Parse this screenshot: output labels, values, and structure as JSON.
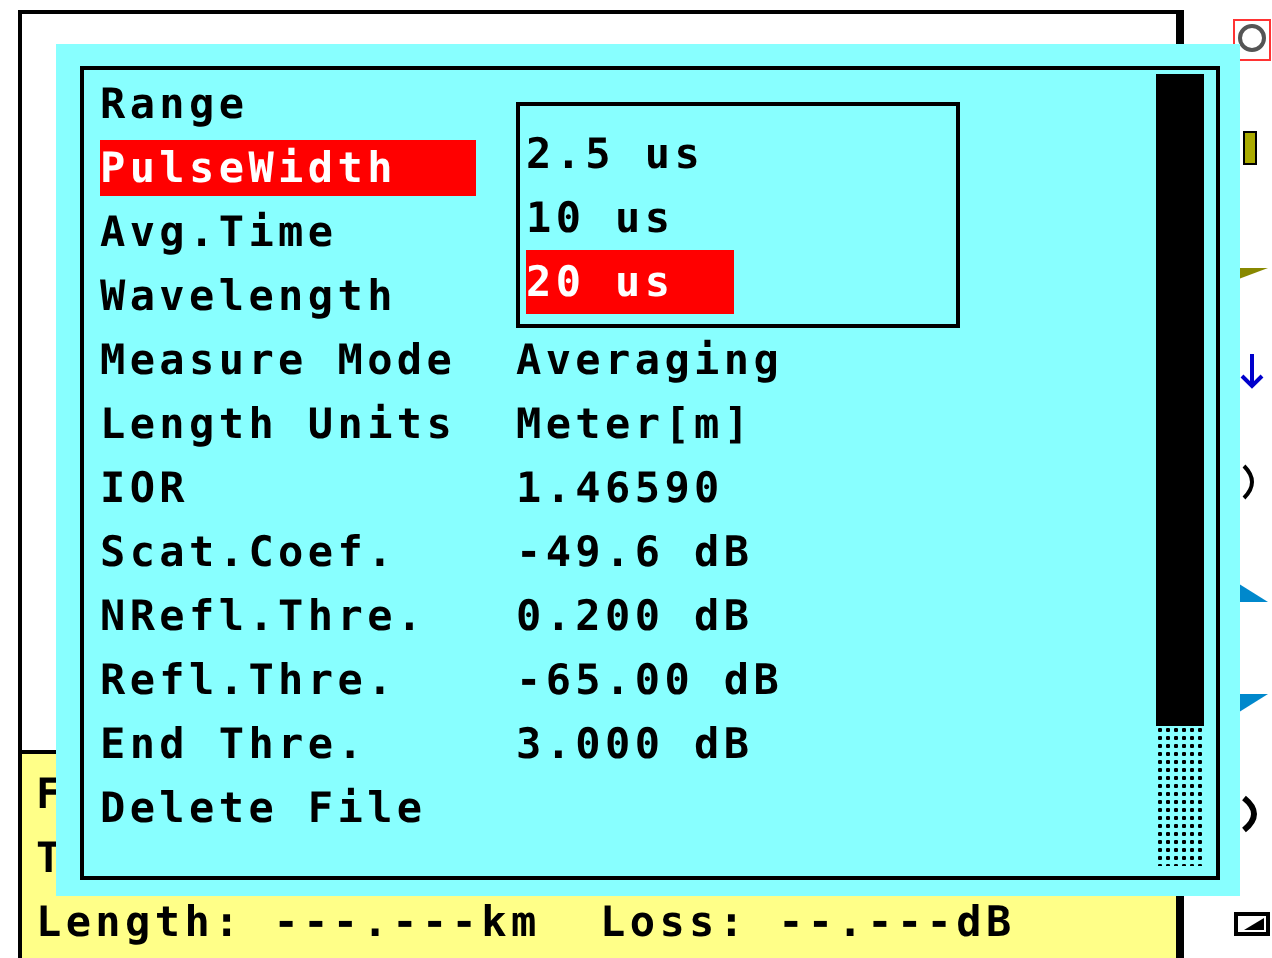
{
  "menu": {
    "items": [
      {
        "label": "Range",
        "selected": false
      },
      {
        "label": "PulseWidth",
        "selected": true
      },
      {
        "label": "Avg.Time",
        "selected": false
      },
      {
        "label": "Wavelength",
        "selected": false
      },
      {
        "label": "Measure Mode",
        "value": "Averaging",
        "selected": false
      },
      {
        "label": "Length Units",
        "value": "Meter[m]",
        "selected": false
      },
      {
        "label": "IOR",
        "value": "1.46590",
        "selected": false
      },
      {
        "label": "Scat.Coef.",
        "value": "-49.6 dB",
        "selected": false
      },
      {
        "label": "NRefl.Thre.",
        "value": "0.200 dB",
        "selected": false
      },
      {
        "label": "Refl.Thre.",
        "value": "-65.00 dB",
        "selected": false
      },
      {
        "label": "End Thre.",
        "value": "3.000 dB",
        "selected": false
      },
      {
        "label": "Delete File",
        "selected": false
      }
    ]
  },
  "dropdown": {
    "options": [
      {
        "label": "2.5 us",
        "selected": false
      },
      {
        "label": "10 us",
        "selected": false
      },
      {
        "label": "20 us",
        "selected": true
      }
    ]
  },
  "status": {
    "lines": [
      "F",
      "T",
      "Length: ---.---km  Loss: --.---dB"
    ]
  }
}
